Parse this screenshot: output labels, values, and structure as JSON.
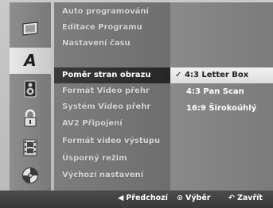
{
  "menu": {
    "items": [
      {
        "label": "Auto programování"
      },
      {
        "label": "Editace Programu"
      },
      {
        "label": "Nastavení času"
      },
      {
        "label": "Poměr stran obrazu"
      },
      {
        "label": "Formát Video přehr"
      },
      {
        "label": "Systém Video přehr"
      },
      {
        "label": "AV2 Připojení"
      },
      {
        "label": "Formát video výstupu"
      },
      {
        "label": "Úsporný režim"
      },
      {
        "label": "Výchozí nastavení"
      }
    ],
    "selected_index": 3
  },
  "options": {
    "items": [
      {
        "label": "4:3 Letter Box"
      },
      {
        "label": "4:3 Pan Scan"
      },
      {
        "label": "16:9 Širokoúhlý"
      }
    ],
    "check_glyph": "✓"
  },
  "icons": [
    {
      "name": "tv-screen-icon"
    },
    {
      "name": "language-a-icon"
    },
    {
      "name": "speaker-icon"
    },
    {
      "name": "lock-icon"
    },
    {
      "name": "film-strip-icon"
    },
    {
      "name": "disc-icon"
    }
  ],
  "footer": {
    "prev": {
      "glyph": "◀",
      "label": "Předchozí"
    },
    "select": {
      "glyph": "⊙",
      "label": "Výběr"
    },
    "close": {
      "glyph": "↶",
      "label": "Zavřít"
    }
  }
}
